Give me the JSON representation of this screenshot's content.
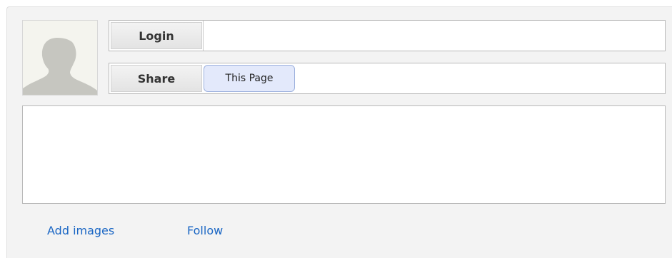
{
  "profile": {
    "avatar_icon": "default-user-silhouette-icon"
  },
  "login": {
    "label": "Login",
    "value": ""
  },
  "share": {
    "label": "Share",
    "button_label": "This Page"
  },
  "content": {
    "text": ""
  },
  "footer_links": {
    "add_images": "Add images",
    "follow": "Follow"
  },
  "colors": {
    "link": "#1a66c4",
    "button_bg": "#e3e9fb",
    "button_border": "#9eb2de",
    "panel_bg": "#f3f3f3"
  }
}
